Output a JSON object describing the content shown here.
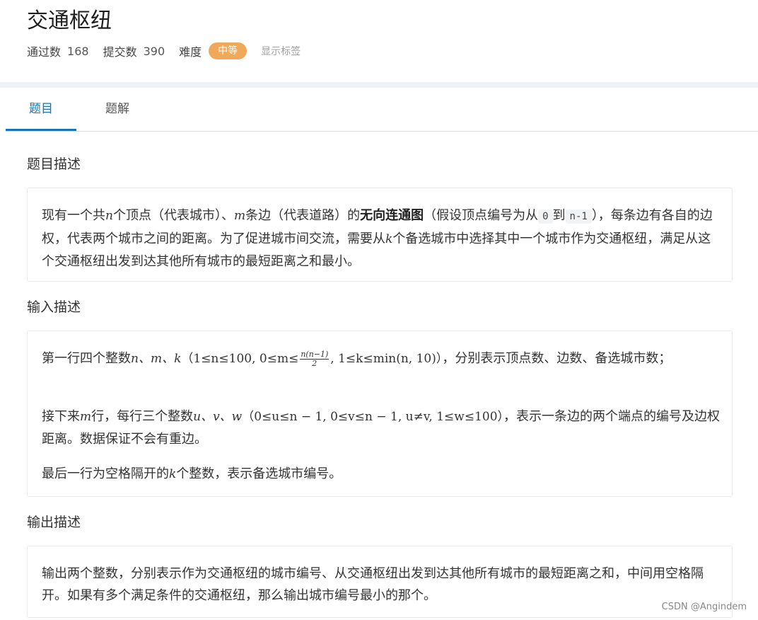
{
  "problem": {
    "title": "交通枢纽",
    "accepted_label": "通过数",
    "accepted_count": "168",
    "submitted_label": "提交数",
    "submitted_count": "390",
    "difficulty_label": "难度",
    "difficulty_value": "中等",
    "show_tags_label": "显示标签"
  },
  "tabs": [
    {
      "label": "题目",
      "active": true
    },
    {
      "label": "题解",
      "active": false
    }
  ],
  "sections": {
    "description_title": "题目描述",
    "description": {
      "t1": "现有一个共",
      "var_n": "n",
      "t2": "个顶点（代表城市）、",
      "var_m": "m",
      "t3": "条边（代表道路）的",
      "bold": "无向连通图",
      "t4": "（假设顶点编号为从",
      "code_0": "0",
      "t5": "到",
      "code_n1": "n-1",
      "t6": "），每条边有各自的边权，代表两个城市之间的距离。为了促进城市间交流，需要从",
      "var_k": "k",
      "t7": "个备选城市中选择其中一个城市作为交通枢纽，满足从这个交通枢纽出发到达其他所有城市的最短距离之和最小。"
    },
    "input_title": "输入描述",
    "input": {
      "p1_t1": "第一行四个整数",
      "p1_vars": "n、m、k",
      "p1_constraint_a": "（1≤n≤100, 0≤m≤",
      "p1_frac_num": "n(n−1)",
      "p1_frac_den": "2",
      "p1_constraint_b": ", 1≤k≤min(n, 10)）",
      "p1_t2": "，分别表示顶点数、边数、备选城市数；",
      "p2_t1": "接下来",
      "p2_var_m": "m",
      "p2_t2": "行，每行三个整数",
      "p2_vars": "u、v、w",
      "p2_constraint": "（0≤u≤n − 1, 0≤v≤n − 1, u≠v, 1≤w≤100）",
      "p2_t3": "，表示一条边的两个端点的编号及边权距离。数据保证不会有重边。",
      "p3_t1": "最后一行为空格隔开的",
      "p3_var_k": "k",
      "p3_t2": "个整数，表示备选城市编号。"
    },
    "output_title": "输出描述",
    "output": "输出两个整数，分别表示作为交通枢纽的城市编号、从交通枢纽出发到达其他所有城市的最短距离之和，中间用空格隔开。如果有多个满足条件的交通枢纽，那么输出城市编号最小的那个。"
  },
  "watermark": "CSDN @Angindem",
  "colors": {
    "accent": "#1a73b8",
    "difficulty_badge": "#f0a85a",
    "band": "#eef1f6"
  }
}
